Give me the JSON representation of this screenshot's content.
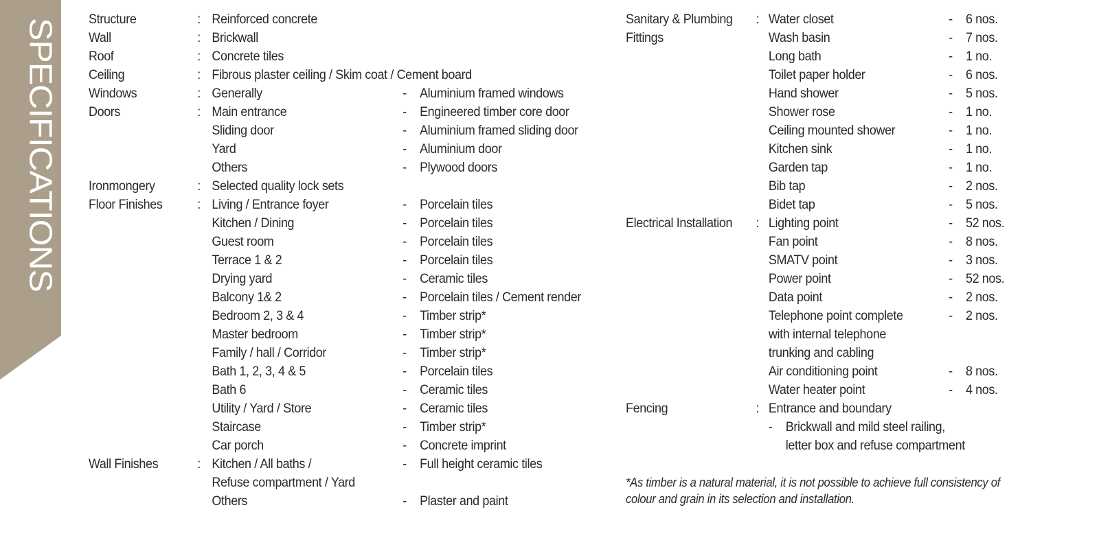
{
  "banner": {
    "title": "SPECIFICATIONS",
    "color": "#ab9f8b"
  },
  "left_column": [
    {
      "label": "Structure",
      "item": "Reinforced concrete"
    },
    {
      "label": "Wall",
      "item": "Brickwall"
    },
    {
      "label": "Roof",
      "item": "Concrete tiles"
    },
    {
      "label": "Ceiling",
      "item": "Fibrous plaster ceiling / Skim coat / Cement board"
    },
    {
      "label": "Windows",
      "item": "Generally",
      "value": "Aluminium framed windows"
    },
    {
      "label": "Doors",
      "item": "Main entrance",
      "value": "Engineered timber core door"
    },
    {
      "item": "Sliding door",
      "value": "Aluminium framed sliding door"
    },
    {
      "item": "Yard",
      "value": "Aluminium door"
    },
    {
      "item": "Others",
      "value": "Plywood doors"
    },
    {
      "label": "Ironmongery",
      "item": "Selected quality lock sets"
    },
    {
      "label": "Floor Finishes",
      "item": "Living / Entrance foyer",
      "value": "Porcelain tiles"
    },
    {
      "item": "Kitchen / Dining",
      "value": "Porcelain tiles"
    },
    {
      "item": "Guest room",
      "value": "Porcelain tiles"
    },
    {
      "item": "Terrace 1 & 2",
      "value": "Porcelain tiles"
    },
    {
      "item": "Drying yard",
      "value": "Ceramic tiles"
    },
    {
      "item": "Balcony 1& 2",
      "value": "Porcelain tiles / Cement render"
    },
    {
      "item": "Bedroom 2, 3 & 4",
      "value": "Timber strip*"
    },
    {
      "item": "Master bedroom",
      "value": "Timber strip*"
    },
    {
      "item": "Family / hall / Corridor",
      "value": "Timber strip*"
    },
    {
      "item": "Bath 1, 2, 3, 4 & 5",
      "value": "Porcelain tiles"
    },
    {
      "item": "Bath 6",
      "value": "Ceramic tiles"
    },
    {
      "item": "Utility / Yard / Store",
      "value": "Ceramic tiles"
    },
    {
      "item": "Staircase",
      "value": "Timber strip*"
    },
    {
      "item": "Car porch",
      "value": "Concrete imprint"
    },
    {
      "label": "Wall Finishes",
      "item": "Kitchen / All baths /",
      "value": "Full height ceramic tiles"
    },
    {
      "item": "Refuse compartment / Yard"
    },
    {
      "item": "Others",
      "value": "Plaster and paint"
    }
  ],
  "right_column": [
    {
      "label": "Sanitary & Plumbing",
      "item": "Water closet",
      "value": "6 nos."
    },
    {
      "label": "Fittings",
      "item": "Wash basin",
      "value": "7 nos.",
      "no_colon": true
    },
    {
      "item": "Long bath",
      "value": "1 no."
    },
    {
      "item": "Toilet paper holder",
      "value": "6 nos."
    },
    {
      "item": "Hand shower",
      "value": "5 nos."
    },
    {
      "item": "Shower rose",
      "value": "1 no."
    },
    {
      "item": "Ceiling mounted shower",
      "value": "1 no."
    },
    {
      "item": "Kitchen sink",
      "value": "1 no."
    },
    {
      "item": "Garden tap",
      "value": "1 no."
    },
    {
      "item": "Bib tap",
      "value": "2 nos."
    },
    {
      "item": "Bidet tap",
      "value": "5 nos."
    },
    {
      "label": "Electrical Installation",
      "item": "Lighting point",
      "value": "52 nos."
    },
    {
      "item": "Fan point",
      "value": "8 nos."
    },
    {
      "item": "SMATV point",
      "value": "3 nos."
    },
    {
      "item": "Power point",
      "value": "52 nos."
    },
    {
      "item": "Data point",
      "value": "2 nos."
    },
    {
      "item": "Telephone point complete",
      "value": "2 nos."
    },
    {
      "item": "with internal telephone"
    },
    {
      "item": "trunking and cabling"
    },
    {
      "item": "Air conditioning point",
      "value": "8 nos."
    },
    {
      "item": "Water heater point",
      "value": "4 nos."
    },
    {
      "label": "Fencing",
      "item": "Entrance and boundary"
    },
    {
      "sub": "Brickwall and mild steel railing,",
      "sub_dash": true
    },
    {
      "sub": "letter box and refuse compartment"
    }
  ],
  "separators": {
    "colon": ":",
    "dash": "-"
  },
  "footnote": {
    "line1": "*As timber is a natural material, it is not possible to achieve full consistency of",
    "line2": "colour and grain in its selection and installation."
  }
}
